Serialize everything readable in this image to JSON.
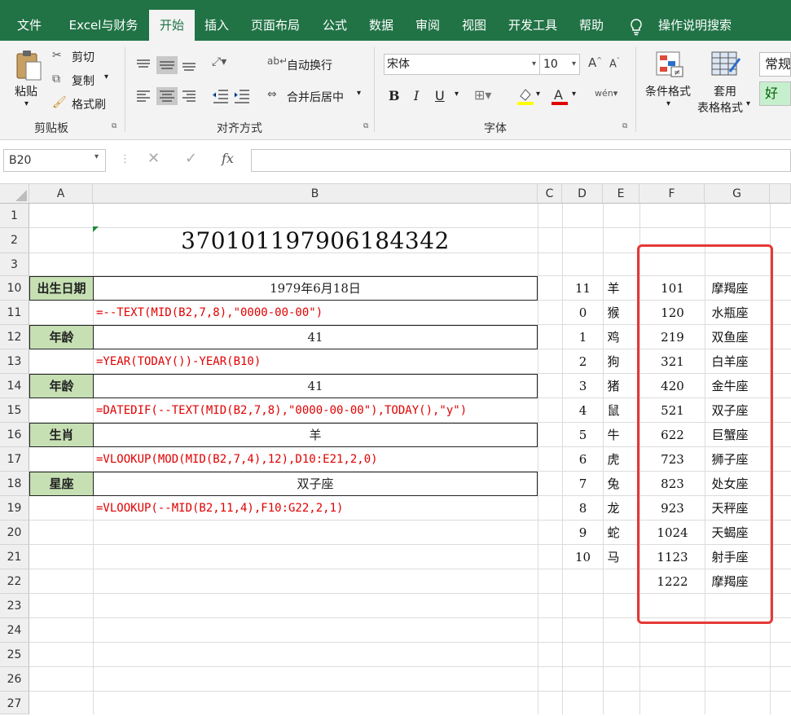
{
  "menu": {
    "tabs": [
      "文件",
      "Excel与财务",
      "开始",
      "插入",
      "页面布局",
      "公式",
      "数据",
      "审阅",
      "视图",
      "开发工具",
      "帮助"
    ],
    "search": "操作说明搜索"
  },
  "ribbon": {
    "paste": "粘贴",
    "cut": "剪切",
    "copy": "复制",
    "format_painter": "格式刷",
    "clipboard": "剪贴板",
    "wrap": "自动换行",
    "merge": "合并后居中",
    "align": "对齐方式",
    "font_name": "宋体",
    "font_size": "10",
    "font_group": "字体",
    "bold": "B",
    "italic": "I",
    "underline": "U",
    "cond1": "条件格式",
    "table1": "套用",
    "table2": "表格格式",
    "style_normal": "常规",
    "style_good": "好"
  },
  "formula_bar": {
    "name_box": "B20",
    "fx": "fx"
  },
  "columns": [
    "A",
    "B",
    "C",
    "D",
    "E",
    "F",
    "G"
  ],
  "rows": [
    "1",
    "2",
    "3",
    "10",
    "11",
    "12",
    "13",
    "14",
    "15",
    "16",
    "17",
    "18",
    "19",
    "20",
    "21",
    "22",
    "23",
    "24",
    "25",
    "26",
    "27"
  ],
  "sheet": {
    "id_number": "370101197906184342",
    "labels": {
      "birth": "出生日期",
      "age1": "年龄",
      "age2": "年龄",
      "zodiac": "生肖",
      "star": "星座"
    },
    "values": {
      "birth": "1979年6月18日",
      "age1": "41",
      "age2": "41",
      "zodiac": "羊",
      "star": "双子座"
    },
    "formulas": {
      "f11": "=--TEXT(MID(B2,7,8),\"0000-00-00\")",
      "f13": "=YEAR(TODAY())-YEAR(B10)",
      "f15": "=DATEDIF(--TEXT(MID(B2,7,8),\"0000-00-00\"),TODAY(),\"y\")",
      "f17": "=VLOOKUP(MOD(MID(B2,7,4),12),D10:E21,2,0)",
      "f19": "=VLOOKUP(--MID(B2,11,4),F10:G22,2,1)"
    },
    "zodiac_table": [
      {
        "num": "11",
        "animal": "羊"
      },
      {
        "num": "0",
        "animal": "猴"
      },
      {
        "num": "1",
        "animal": "鸡"
      },
      {
        "num": "2",
        "animal": "狗"
      },
      {
        "num": "3",
        "animal": "猪"
      },
      {
        "num": "4",
        "animal": "鼠"
      },
      {
        "num": "5",
        "animal": "牛"
      },
      {
        "num": "6",
        "animal": "虎"
      },
      {
        "num": "7",
        "animal": "兔"
      },
      {
        "num": "8",
        "animal": "龙"
      },
      {
        "num": "9",
        "animal": "蛇"
      },
      {
        "num": "10",
        "animal": "马"
      }
    ],
    "star_table": [
      {
        "date": "101",
        "sign": "摩羯座"
      },
      {
        "date": "120",
        "sign": "水瓶座"
      },
      {
        "date": "219",
        "sign": "双鱼座"
      },
      {
        "date": "321",
        "sign": "白羊座"
      },
      {
        "date": "420",
        "sign": "金牛座"
      },
      {
        "date": "521",
        "sign": "双子座"
      },
      {
        "date": "622",
        "sign": "巨蟹座"
      },
      {
        "date": "723",
        "sign": "狮子座"
      },
      {
        "date": "823",
        "sign": "处女座"
      },
      {
        "date": "923",
        "sign": "天秤座"
      },
      {
        "date": "1024",
        "sign": "天蝎座"
      },
      {
        "date": "1123",
        "sign": "射手座"
      },
      {
        "date": "1222",
        "sign": "摩羯座"
      }
    ]
  },
  "colors": {
    "excel_green": "#217346",
    "label_fill": "#c6e0b4",
    "formula_red": "#e00000",
    "highlight_box": "#e53935"
  }
}
